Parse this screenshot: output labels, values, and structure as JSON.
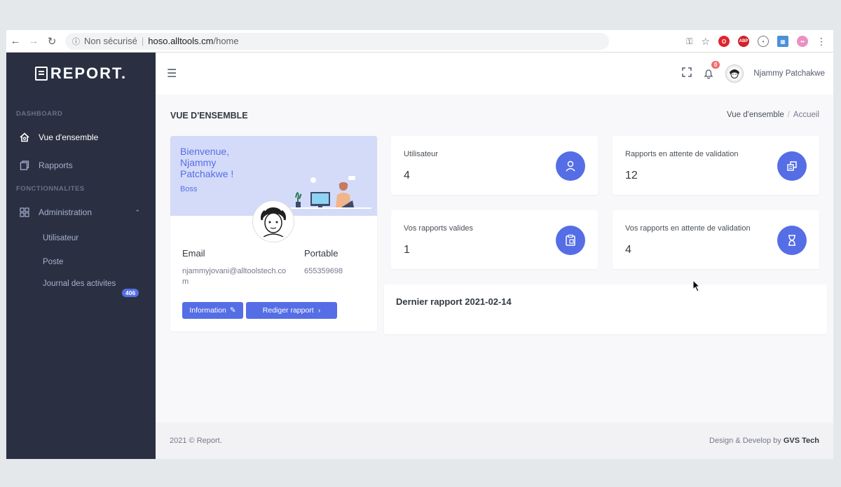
{
  "browser": {
    "security": "Non sécurisé",
    "host": "hoso.alltools.cm",
    "path": "/home"
  },
  "sidebar": {
    "logo": "REPORT.",
    "section_dashboard": "DASHBOARD",
    "items": [
      {
        "label": "Vue d'ensemble",
        "icon": "home-icon",
        "active": true
      },
      {
        "label": "Rapports",
        "icon": "copy-icon",
        "active": false
      }
    ],
    "section_features": "FONCTIONNALITES",
    "admin": {
      "label": "Administration",
      "icon": "grid-icon",
      "expanded": true
    },
    "sub_items": [
      {
        "label": "Utilisateur"
      },
      {
        "label": "Poste"
      },
      {
        "label": "Journal des activites",
        "badge": "406"
      }
    ]
  },
  "header": {
    "notifications": "0",
    "user_name": "Njammy Patchakwe"
  },
  "page": {
    "title": "VUE D'ENSEMBLE",
    "breadcrumb": [
      "Vue d'ensemble",
      "Accueil"
    ]
  },
  "profile": {
    "welcome": "Bienvenue, Njammy Patchakwe !",
    "role": "Boss",
    "email_label": "Email",
    "email_value": "njammyjovani@alltoolstech.com",
    "phone_label": "Portable",
    "phone_value": "655359698",
    "info_button": "Information",
    "report_button": "Rediger rapport"
  },
  "stats": [
    {
      "label": "Utilisateur",
      "value": "4",
      "icon": "user-icon"
    },
    {
      "label": "Rapports en attente de validation",
      "value": "12",
      "icon": "copy-icon"
    },
    {
      "label": "Vos rapports valides",
      "value": "1",
      "icon": "clipboard-icon"
    },
    {
      "label": "Vos rapports en attente de validation",
      "value": "4",
      "icon": "hourglass-icon"
    }
  ],
  "last_report": {
    "title": "Dernier rapport 2021-02-14"
  },
  "footer": {
    "left": "2021 © Report.",
    "right_prefix": "Design & Develop by",
    "right_brand": "GVS Tech"
  },
  "colors": {
    "primary": "#556ee6",
    "sidebar": "#2a3042",
    "profile_header": "#d4dbf9"
  }
}
